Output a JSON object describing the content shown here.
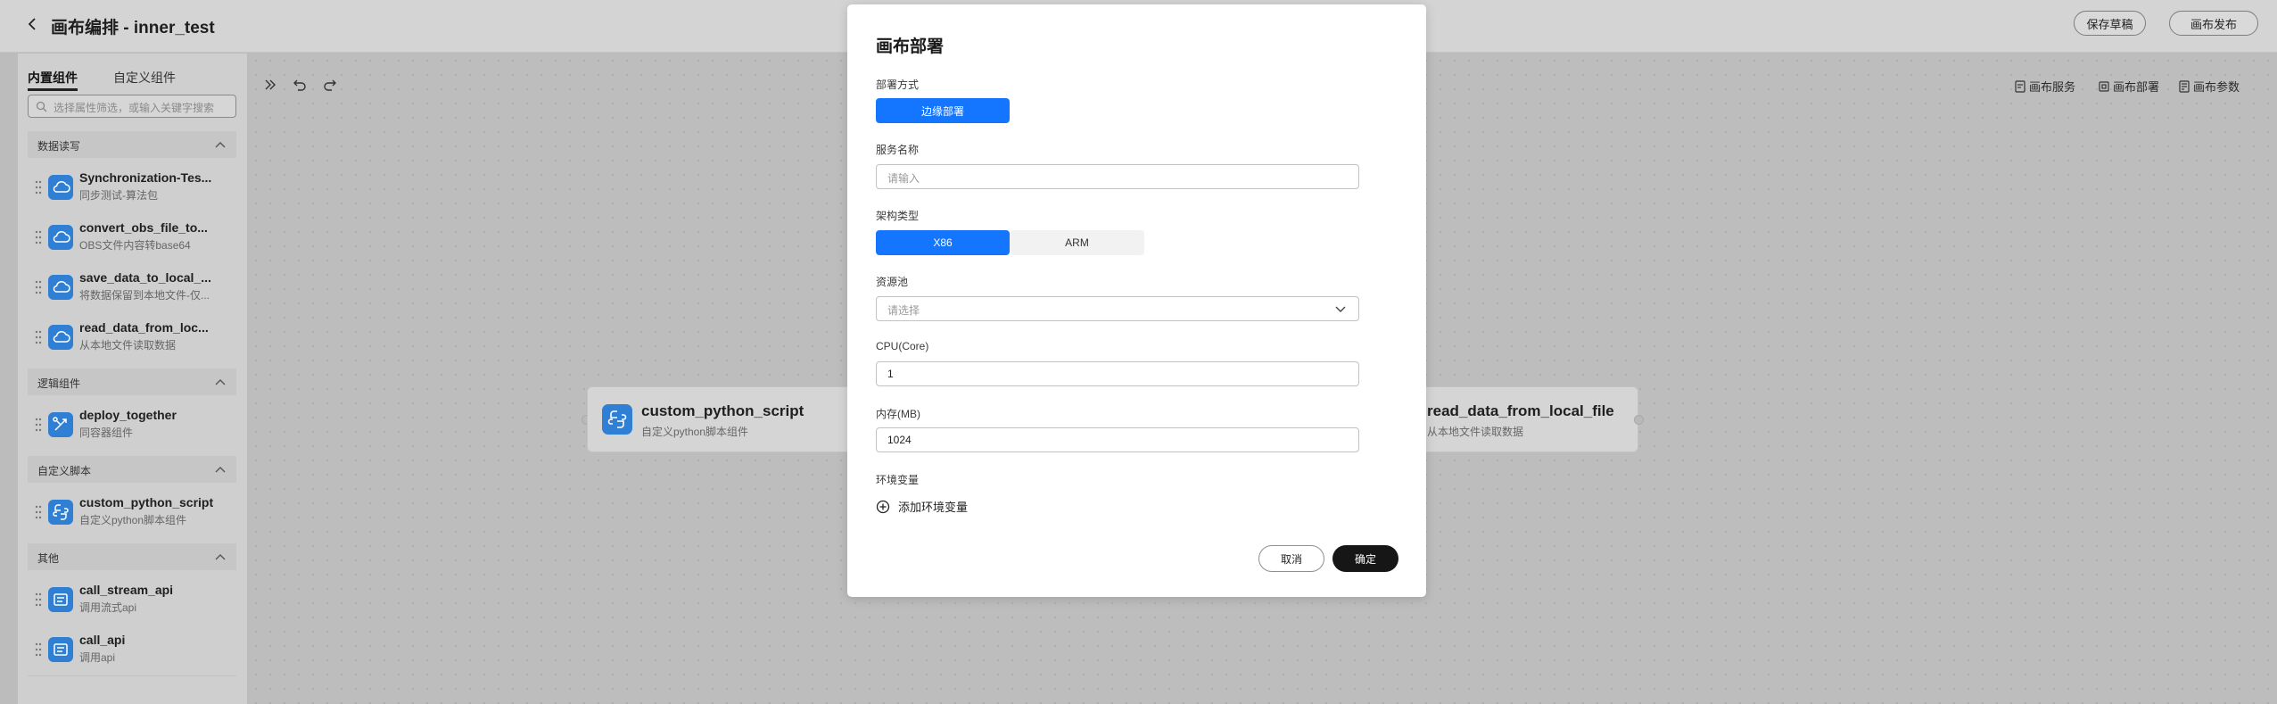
{
  "header": {
    "title": "画布编排 - inner_test",
    "save_draft": "保存草稿",
    "publish": "画布发布"
  },
  "sidebar": {
    "tabs": [
      "内置组件",
      "自定义组件"
    ],
    "search_placeholder": "选择属性筛选，或输入关键字搜索",
    "groups": [
      {
        "label": "数据读写",
        "items": [
          {
            "title": "Synchronization-Tes...",
            "subtitle": "同步测试-算法包",
            "icon": "cloud-icon"
          },
          {
            "title": "convert_obs_file_to...",
            "subtitle": "OBS文件内容转base64",
            "icon": "cloud-icon"
          },
          {
            "title": "save_data_to_local_...",
            "subtitle": "将数据保留到本地文件-仅...",
            "icon": "cloud-icon"
          },
          {
            "title": "read_data_from_loc...",
            "subtitle": "从本地文件读取数据",
            "icon": "cloud-icon"
          }
        ]
      },
      {
        "label": "逻辑组件",
        "items": [
          {
            "title": "deploy_together",
            "subtitle": "同容器组件",
            "icon": "branch-icon"
          }
        ]
      },
      {
        "label": "自定义脚本",
        "items": [
          {
            "title": "custom_python_script",
            "subtitle": "自定义python脚本组件",
            "icon": "python-icon"
          }
        ]
      },
      {
        "label": "其他",
        "items": [
          {
            "title": "call_stream_api",
            "subtitle": "调用流式api",
            "icon": "api-icon"
          },
          {
            "title": "call_api",
            "subtitle": "调用api",
            "icon": "api-icon"
          }
        ]
      }
    ]
  },
  "toolbar": {
    "actions": [
      "画布服务",
      "画布部署",
      "画布参数"
    ]
  },
  "canvas": {
    "nodes": [
      {
        "title": "custom_python_script",
        "subtitle": "自定义python脚本组件",
        "icon": "python-icon"
      },
      {
        "title": "read_data_from_local_file",
        "subtitle": "从本地文件读取数据",
        "icon": "cloud-icon"
      }
    ]
  },
  "dialog": {
    "title": "画布部署",
    "deploy_mode_label": "部署方式",
    "deploy_mode_option": "边缘部署",
    "service_name_label": "服务名称",
    "service_name_placeholder": "请输入",
    "arch_label": "架构类型",
    "arch_options": [
      "X86",
      "ARM"
    ],
    "arch_selected": "X86",
    "pool_label": "资源池",
    "pool_placeholder": "请选择",
    "cpu_label": "CPU(Core)",
    "cpu_value": "1",
    "mem_label": "内存(MB)",
    "mem_value": "1024",
    "env_label": "环境变量",
    "add_env": "添加环境变量",
    "cancel": "取消",
    "confirm": "确定"
  },
  "colors": {
    "primary": "#1476ff",
    "confirm_button": "#161616",
    "component_icon": "#2f7fd4"
  }
}
